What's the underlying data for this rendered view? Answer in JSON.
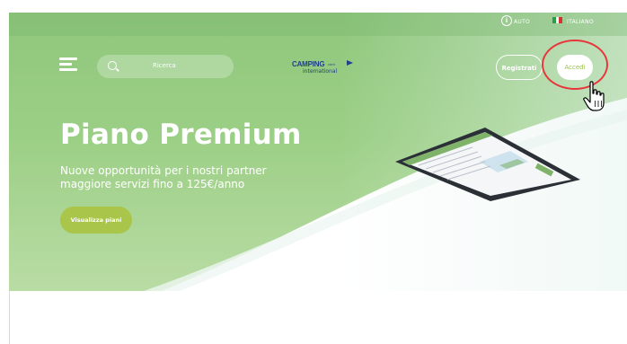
{
  "topbar": {
    "auto_label": "AUTO",
    "language_label": "ITALIANO",
    "icons": [
      "info-icon",
      "italy-flag-icon"
    ]
  },
  "header": {
    "search_placeholder": "Ricerca",
    "logo": {
      "main": "CAMPING",
      "small": "card",
      "sub": "international"
    },
    "register_label": "Registrati",
    "login_label": "Accedi"
  },
  "hero": {
    "title": "Piano Premium",
    "subtitle_line1": "Nuove opportunità per i nostri partner",
    "subtitle_line2": "maggiore servizi fino a 125€/anno",
    "cta_label": "Visualizza piani"
  },
  "colors": {
    "hero_green": "#9ccf86",
    "cta_green": "#a9c64a",
    "login_text": "#9ac24f",
    "logo_blue": "#1d3f8c",
    "highlight_red": "#e8363d"
  }
}
